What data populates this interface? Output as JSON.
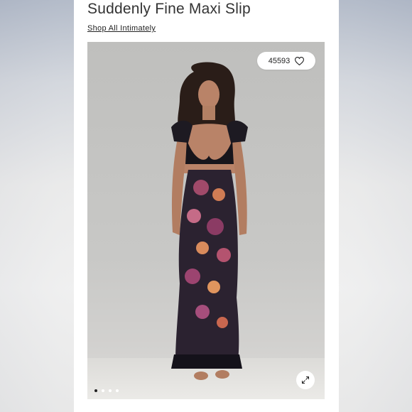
{
  "product": {
    "title": "Suddenly Fine Maxi Slip",
    "collection_link": "Shop All Intimately"
  },
  "gallery": {
    "like_count": "45593",
    "slide_count": 4,
    "active_slide": 1,
    "heart_icon": "heart-icon",
    "expand_icon": "expand-icon"
  },
  "colors": {
    "background": "#f3f3f3",
    "card": "#ffffff",
    "text": "#333333"
  }
}
